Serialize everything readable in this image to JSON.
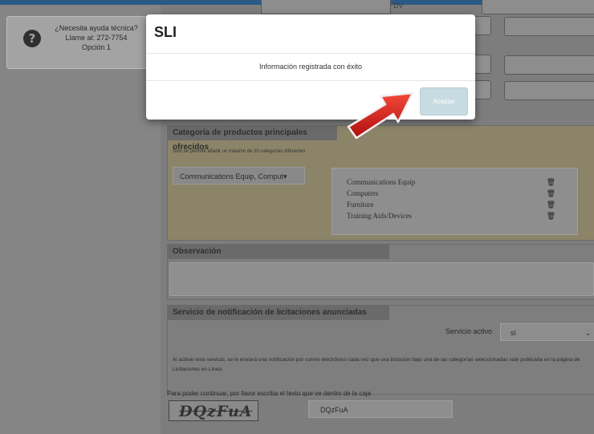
{
  "help": {
    "line1": "¿Necesita ayuda técnica?",
    "line2": "Llame al: 272-7754",
    "line3": "Opción 1"
  },
  "header": {
    "dv_label": "DV"
  },
  "categories": {
    "title": "Categoría de productos principales ofrecidos",
    "note": "Solo se permite añadir un máximo de 20 categorías diferentes",
    "dropdown_value": "Communications Equip, Comput▾",
    "items": [
      {
        "label": "Communications Equip",
        "icon": "trash-icon"
      },
      {
        "label": "Computers",
        "icon": "trash-icon"
      },
      {
        "label": "Furniture",
        "icon": "trash-icon"
      },
      {
        "label": "Training Aids/Devices",
        "icon": "trash-icon"
      }
    ]
  },
  "observacion": {
    "title": "Observación"
  },
  "notificacion": {
    "title": "Servicio de notificación de licitaciones anunciadas",
    "servicio_label": "Servicio activo",
    "servicio_value": "sí",
    "description": "Al activar este servicio, se le enviará una notificación por correo electrónico cada vez que una licitación bajo una de las categorías seleccionadas sale publicada en la página de Licitaciones en Línea."
  },
  "captcha": {
    "instruction": "Para poder continuar, por favor escriba el texto que ve dentro de la caja",
    "image_text": "DQzFuA",
    "input_value": "DQzFuA"
  },
  "modal": {
    "title": "SLI",
    "message": "Información registrada con éxito",
    "accept_label": "Aceptar"
  },
  "colors": {
    "modal_button": "#c7dce2",
    "arrow": "#d8191a",
    "topbar": "#2b5a85"
  }
}
